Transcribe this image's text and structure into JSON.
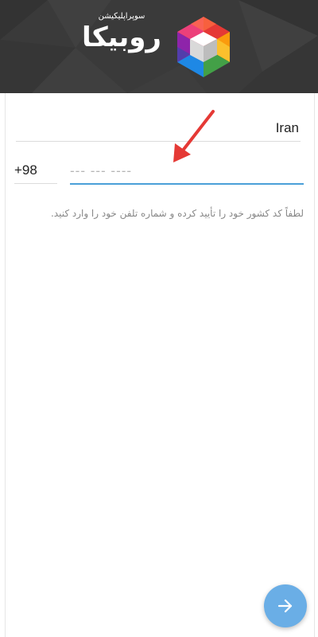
{
  "header": {
    "brand_name": "روبیکا",
    "tagline": "سوپراپلیکیشن"
  },
  "form": {
    "country": "Iran",
    "country_code": "+98",
    "phone_placeholder": "--- --- ----",
    "instructions": "لطفاً کد کشور خود را تأیید کرده و شماره تلفن خود را وارد کنید."
  },
  "icons": {
    "fab": "arrow-right-icon",
    "logo": "rubika-hexagon-logo",
    "annotation": "red-arrow-annotation"
  },
  "colors": {
    "header_bg": "#3a3a3a",
    "accent": "#4a9fd8",
    "fab": "#6aaee6",
    "annotation": "#e53935"
  }
}
